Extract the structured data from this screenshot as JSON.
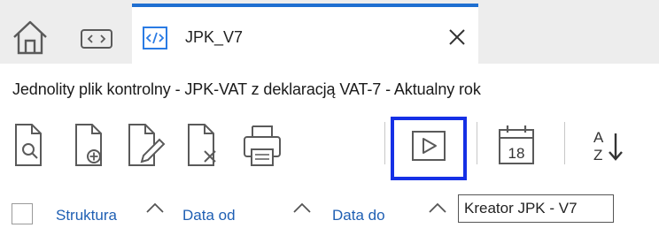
{
  "tabs": {
    "home_icon": "home-icon",
    "nav_icon": "code-nav-icon",
    "active": {
      "icon": "code-icon",
      "label": "JPK_V7",
      "close_icon": "close-icon"
    }
  },
  "document": {
    "title": "Jednolity plik kontrolny - JPK-VAT z deklaracją VAT-7 - Aktualny rok"
  },
  "toolbar": {
    "items": [
      {
        "name": "preview-document",
        "icon": "document-search-icon"
      },
      {
        "name": "add-document",
        "icon": "document-add-icon"
      },
      {
        "name": "edit-document",
        "icon": "document-edit-icon"
      },
      {
        "name": "delete-document",
        "icon": "document-delete-icon"
      },
      {
        "name": "print",
        "icon": "printer-icon"
      },
      {
        "name": "jpk-wizard",
        "icon": "play-icon",
        "selected": true
      },
      {
        "name": "calendar",
        "icon": "calendar-icon",
        "calendar_day": "18"
      },
      {
        "name": "sort",
        "icon": "sort-az-icon",
        "sort_top": "A",
        "sort_bottom": "Z"
      }
    ],
    "selection_color": "#1530e6"
  },
  "columns": [
    {
      "label": "Struktura"
    },
    {
      "label": "Data od"
    },
    {
      "label": "Data do"
    }
  ],
  "tooltip": {
    "text": "Kreator JPK - V7"
  },
  "colors": {
    "accent": "#1f6fd1",
    "column_label": "#1f5fb3",
    "icon_stroke": "#5a5a5a"
  }
}
